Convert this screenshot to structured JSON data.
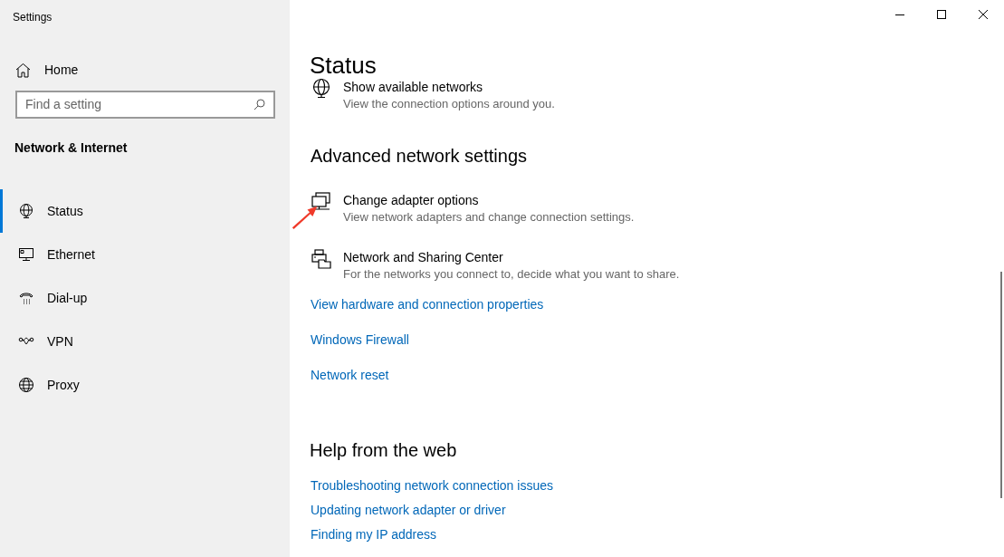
{
  "window": {
    "title": "Settings"
  },
  "sidebar": {
    "home": "Home",
    "search": {
      "placeholder": "Find a setting"
    },
    "section": "Network & Internet",
    "items": [
      {
        "label": "Status",
        "kind": "status",
        "selected": true
      },
      {
        "label": "Ethernet",
        "kind": "ethernet",
        "selected": false
      },
      {
        "label": "Dial-up",
        "kind": "dialup",
        "selected": false
      },
      {
        "label": "VPN",
        "kind": "vpn",
        "selected": false
      },
      {
        "label": "Proxy",
        "kind": "proxy",
        "selected": false
      }
    ]
  },
  "main": {
    "title": "Status",
    "options": [
      {
        "kind": "globe",
        "title": "Show available networks",
        "description": "View the connection options around you."
      }
    ],
    "advanced": {
      "heading": "Advanced network settings",
      "options": [
        {
          "kind": "adapter",
          "title": "Change adapter options",
          "description": "View network adapters and change connection settings.",
          "annotated": true
        },
        {
          "kind": "sharing",
          "title": "Network and Sharing Center",
          "description": "For the networks you connect to, decide what you want to share.",
          "annotated": false
        }
      ],
      "links": [
        "View hardware and connection properties",
        "Windows Firewall",
        "Network reset"
      ]
    },
    "help": {
      "heading": "Help from the web",
      "links": [
        "Troubleshooting network connection issues",
        "Updating network adapter or driver",
        "Finding my IP address"
      ]
    }
  }
}
